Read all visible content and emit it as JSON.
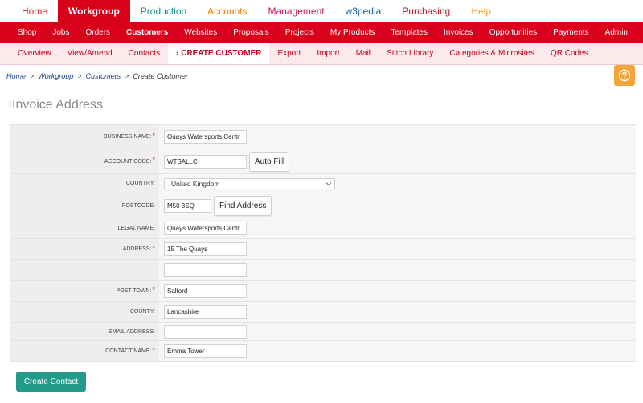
{
  "topnav": [
    "Home",
    "Workgroup",
    "Production",
    "Accounts",
    "Management",
    "w3pedia",
    "Purchasing",
    "Help"
  ],
  "topnav_colors": [
    "#e8202e",
    "#ffffff",
    "#1a8f8a",
    "#ef7c00",
    "#c2185b",
    "#1760a5",
    "#b5172b",
    "#f2a12b"
  ],
  "mainnav": [
    "Shop",
    "Jobs",
    "Orders",
    "Customers",
    "Websites",
    "Proposals",
    "Projects",
    "My Products",
    "Templates",
    "Invoices",
    "Opportunities",
    "Payments",
    "Admin"
  ],
  "subnav": [
    "Overview",
    "View/Amend",
    "Contacts",
    "› CREATE CUSTOMER",
    "Export",
    "Import",
    "Mail",
    "Stitch Library",
    "Categories & Microsites",
    "QR Codes"
  ],
  "breadcrumb": {
    "home": "Home",
    "workgroup": "Workgroup",
    "customers": "Customers",
    "current": "Create Customer",
    "sep": ">"
  },
  "page_title": "Invoice Address",
  "form": {
    "business_name_label": "BUSINESS NAME:",
    "business_name_value": "Quays Watersports Centr",
    "account_code_label": "ACCOUNT CODE:",
    "account_code_value": "WTSALLC",
    "auto_fill_label": "Auto Fill",
    "country_label": "COUNTRY:",
    "country_value": "United Kingdom",
    "postcode_label": "POSTCODE:",
    "postcode_value": "M50 3SQ",
    "find_address_label": "Find Address",
    "legal_name_label": "LEGAL NAME:",
    "legal_name_value": "Quays Watersports Centr",
    "address_label": "ADDRESS:",
    "address_line1_value": "15 The Quays",
    "address_line2_value": "",
    "post_town_label": "POST TOWN:",
    "post_town_value": "Salford",
    "county_label": "COUNTY:",
    "county_value": "Lancashire",
    "email_label": "EMAIL ADDRESS:",
    "email_value": "",
    "contact_name_label": "CONTACT NAME:",
    "contact_name_value": "Emma Tower",
    "required_mark": "*"
  },
  "create_contact_label": "Create Contact"
}
